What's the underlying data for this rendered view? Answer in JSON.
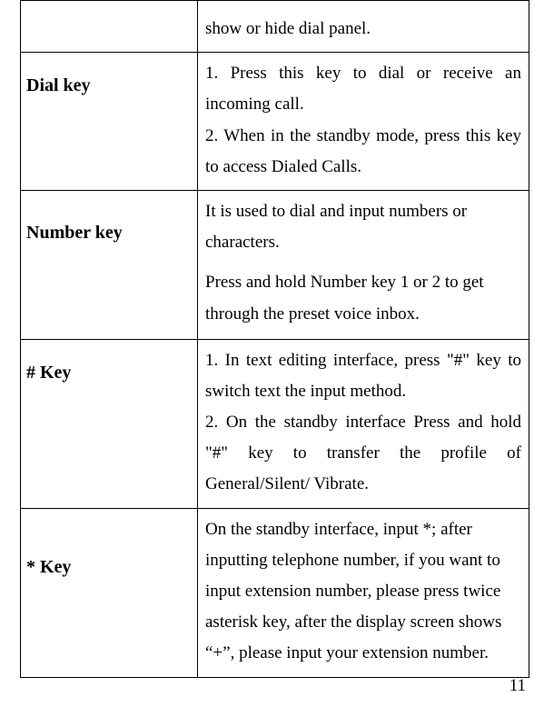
{
  "rows": [
    {
      "key": "",
      "desc": "show or hide dial panel."
    },
    {
      "key": "Dial key",
      "desc": "1. Press this key to dial or receive an incoming call.\n2. When in the standby mode, press this key to access Dialed Calls."
    },
    {
      "key": "Number key",
      "desc_p1": "It is used to dial and input numbers or characters.",
      "desc_p2": "Press and hold Number key 1 or 2 to get through the preset voice inbox."
    },
    {
      "key": "# Key",
      "desc": "1. In text editing interface, press \"#\" key to switch text the input method.\n2. On the standby interface Press and hold \"#\" key to transfer the profile of General/Silent/ Vibrate."
    },
    {
      "key": "* Key",
      "desc": "On the standby interface, input *; after inputting telephone number, if you want to input extension number, please press twice asterisk key, after the display screen shows “+”, please input your extension number."
    }
  ],
  "page_number": "11"
}
